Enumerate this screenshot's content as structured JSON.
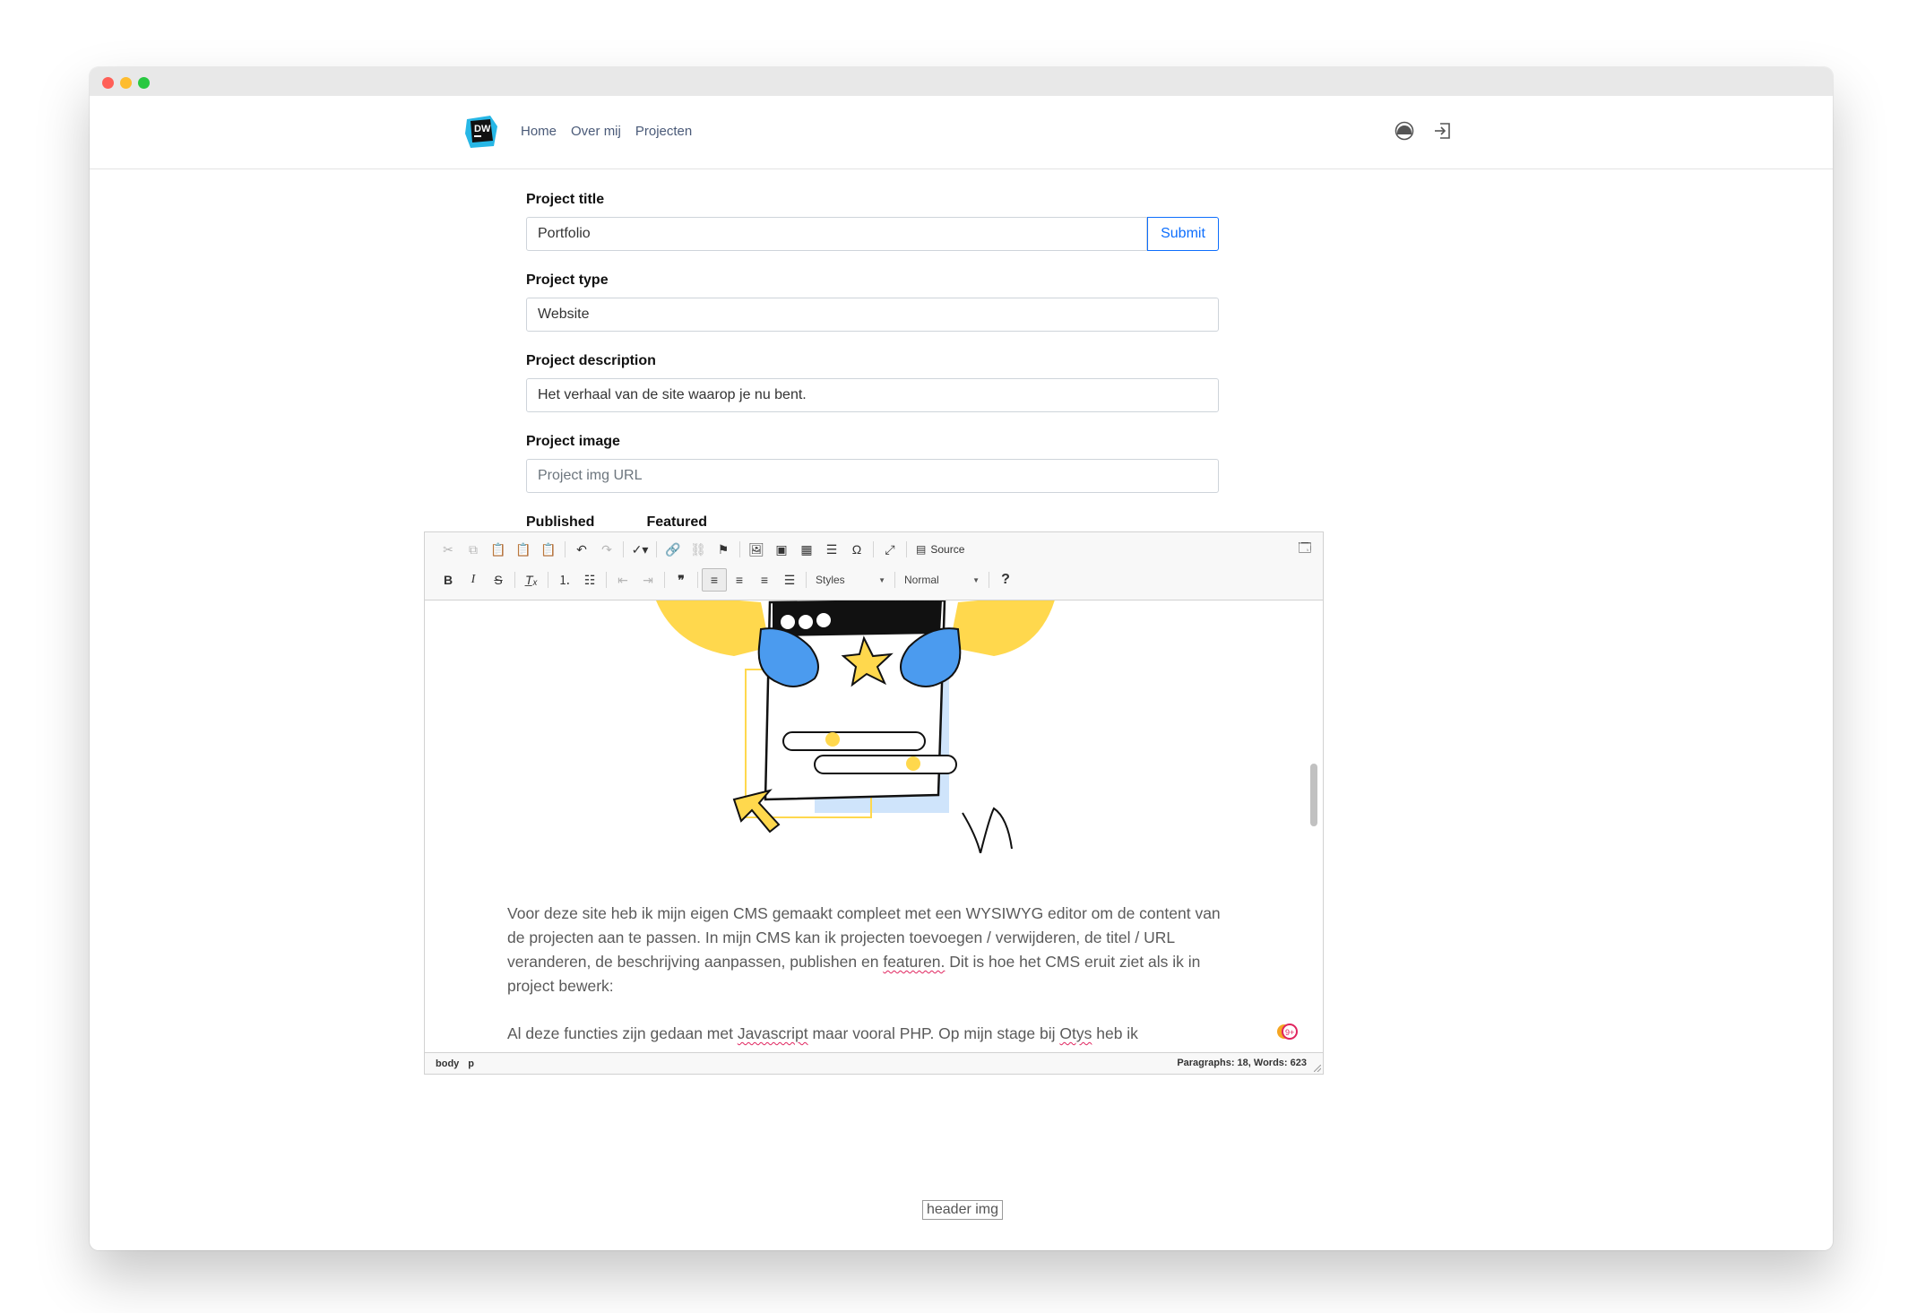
{
  "nav": {
    "links": [
      "Home",
      "Over mij",
      "Projecten"
    ],
    "logo_text": "DW",
    "icons": [
      "dashboard-icon",
      "login-icon"
    ]
  },
  "form": {
    "title_label": "Project title",
    "title_value": "Portfolio",
    "submit_label": "Submit",
    "type_label": "Project type",
    "type_value": "Website",
    "description_label": "Project description",
    "description_value": "Het verhaal van de site waarop je nu bent.",
    "image_label": "Project image",
    "image_placeholder": "Project img URL",
    "published_label": "Published",
    "published": false,
    "featured_label": "Featured",
    "featured": false
  },
  "editor": {
    "source_label": "Source",
    "styles_label": "Styles",
    "format_label": "Normal",
    "help_label": "?",
    "para1": {
      "before": "Voor deze site heb ik mijn eigen CMS gemaakt compleet met een WYSIWYG editor om de content van de projecten aan te passen. In mijn CMS kan ik projecten toevoegen / verwijderen, de titel / URL veranderen, de beschrijving aanpassen, publishen en ",
      "misspelled": "featuren.",
      "after": " Dit is hoe het CMS eruit ziet als ik in project bewerk:"
    },
    "para2": {
      "t1": "Al deze functies zijn gedaan met ",
      "m1": "Javascript",
      "t2": " maar vooral PHP. Op mijn stage bij ",
      "m2": "Otys",
      "t3": " heb ik"
    },
    "status_path": [
      "body",
      "p"
    ],
    "status_count": "Paragraphs: 18, Words: 623"
  },
  "footer": {
    "header_img_alt": "header img"
  },
  "colors": {
    "accent": "#0d6efd",
    "nav_link": "#4a5a78",
    "illustration_yellow": "#ffd84d",
    "illustration_blue": "#4b9bef",
    "illustration_light_blue": "#cfe4fb"
  }
}
